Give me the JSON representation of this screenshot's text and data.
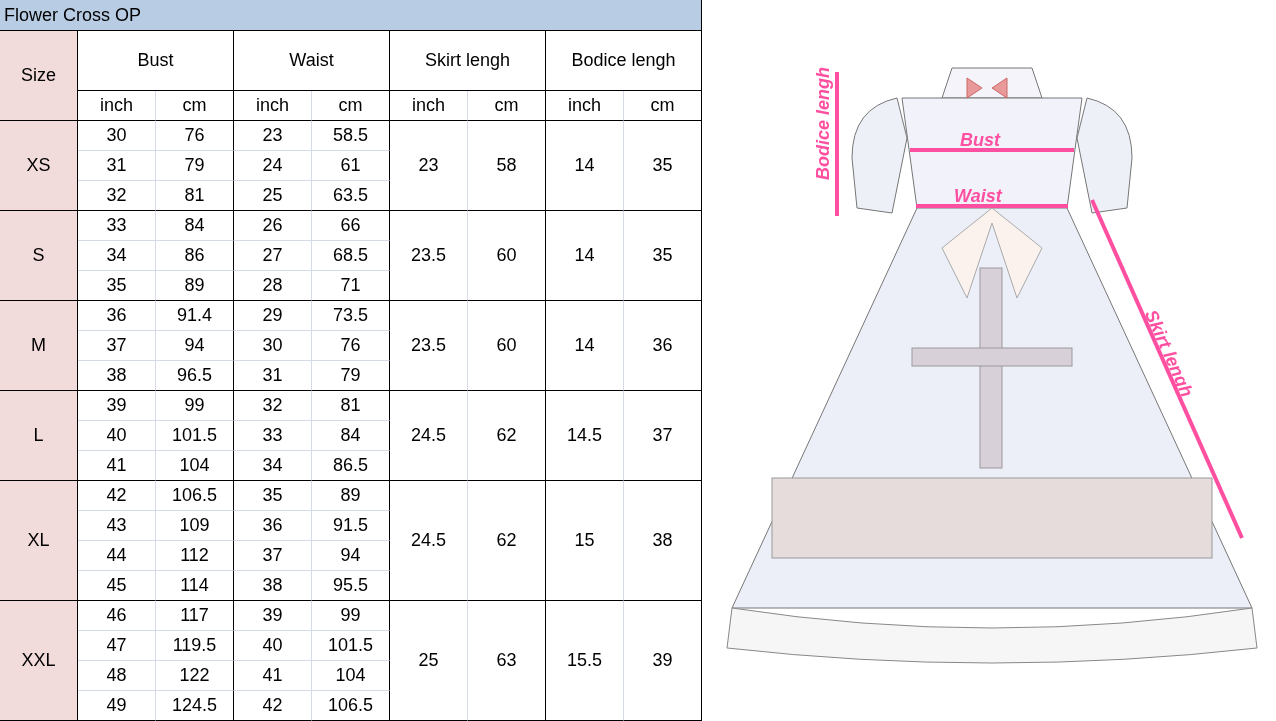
{
  "title": "Flower Cross OP",
  "size_header": "Size",
  "groups": [
    {
      "label": "Bust",
      "units": [
        "inch",
        "cm"
      ]
    },
    {
      "label": "Waist",
      "units": [
        "inch",
        "cm"
      ]
    },
    {
      "label": "Skirt lengh",
      "units": [
        "inch",
        "cm"
      ]
    },
    {
      "label": "Bodice lengh",
      "units": [
        "inch",
        "cm"
      ]
    }
  ],
  "sizes": [
    {
      "size": "XS",
      "rows": [
        [
          "30",
          "76",
          "23",
          "58.5"
        ],
        [
          "31",
          "79",
          "24",
          "61"
        ],
        [
          "32",
          "81",
          "25",
          "63.5"
        ]
      ],
      "skirt_inch": "23",
      "skirt_cm": "58",
      "bodice_inch": "14",
      "bodice_cm": "35"
    },
    {
      "size": "S",
      "rows": [
        [
          "33",
          "84",
          "26",
          "66"
        ],
        [
          "34",
          "86",
          "27",
          "68.5"
        ],
        [
          "35",
          "89",
          "28",
          "71"
        ]
      ],
      "skirt_inch": "23.5",
      "skirt_cm": "60",
      "bodice_inch": "14",
      "bodice_cm": "35"
    },
    {
      "size": "M",
      "rows": [
        [
          "36",
          "91.4",
          "29",
          "73.5"
        ],
        [
          "37",
          "94",
          "30",
          "76"
        ],
        [
          "38",
          "96.5",
          "31",
          "79"
        ]
      ],
      "skirt_inch": "23.5",
      "skirt_cm": "60",
      "bodice_inch": "14",
      "bodice_cm": "36"
    },
    {
      "size": "L",
      "rows": [
        [
          "39",
          "99",
          "32",
          "81"
        ],
        [
          "40",
          "101.5",
          "33",
          "84"
        ],
        [
          "41",
          "104",
          "34",
          "86.5"
        ]
      ],
      "skirt_inch": "24.5",
      "skirt_cm": "62",
      "bodice_inch": "14.5",
      "bodice_cm": "37"
    },
    {
      "size": "XL",
      "rows": [
        [
          "42",
          "106.5",
          "35",
          "89"
        ],
        [
          "43",
          "109",
          "36",
          "91.5"
        ],
        [
          "44",
          "112",
          "37",
          "94"
        ],
        [
          "45",
          "114",
          "38",
          "95.5"
        ]
      ],
      "skirt_inch": "24.5",
      "skirt_cm": "62",
      "bodice_inch": "15",
      "bodice_cm": "38"
    },
    {
      "size": "XXL",
      "rows": [
        [
          "46",
          "117",
          "39",
          "99"
        ],
        [
          "47",
          "119.5",
          "40",
          "101.5"
        ],
        [
          "48",
          "122",
          "41",
          "104"
        ],
        [
          "49",
          "124.5",
          "42",
          "106.5"
        ]
      ],
      "skirt_inch": "25",
      "skirt_cm": "63",
      "bodice_inch": "15.5",
      "bodice_cm": "39"
    }
  ],
  "diagram": {
    "bodice_label": "Bodice lengh",
    "bust_label": "Bust",
    "waist_label": "Waist",
    "skirt_label": "Skirt lengh"
  }
}
